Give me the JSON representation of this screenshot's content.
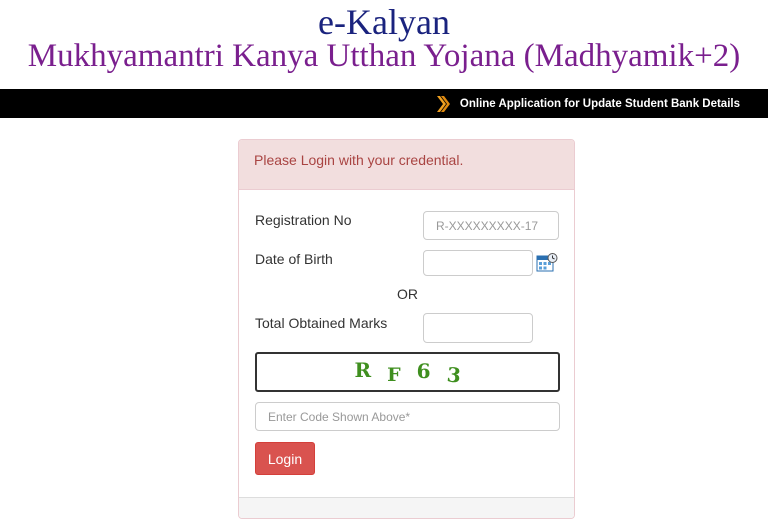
{
  "header": {
    "title": "e-Kalyan",
    "subtitle": "Mukhyamantri Kanya Utthan Yojana (Madhyamik+2)"
  },
  "topbar": {
    "link_label": "Online Application for Update Student Bank Details",
    "link_icon": "double-chevron-right-icon"
  },
  "login_panel": {
    "heading": "Please Login with your credential.",
    "registration": {
      "label": "Registration No",
      "placeholder": "R-XXXXXXXXX-17",
      "value": ""
    },
    "dob": {
      "label": "Date of Birth",
      "value": "",
      "picker_icon": "calendar-icon"
    },
    "or_label": "OR",
    "marks": {
      "label": "Total Obtained Marks",
      "value": ""
    },
    "captcha": {
      "chars": [
        "R",
        "F",
        "6",
        "3"
      ]
    },
    "captcha_input": {
      "placeholder": "Enter Code Shown Above*",
      "value": ""
    },
    "login_label": "Login"
  },
  "colors": {
    "title": "#1a237e",
    "subtitle": "#7a1f8e",
    "topbar_bg": "#000000",
    "arrow": "#f0a020",
    "alert_bg": "#f2dede",
    "alert_text": "#a94442",
    "button_bg": "#d9534f",
    "captcha_text": "#3f8f1f"
  }
}
